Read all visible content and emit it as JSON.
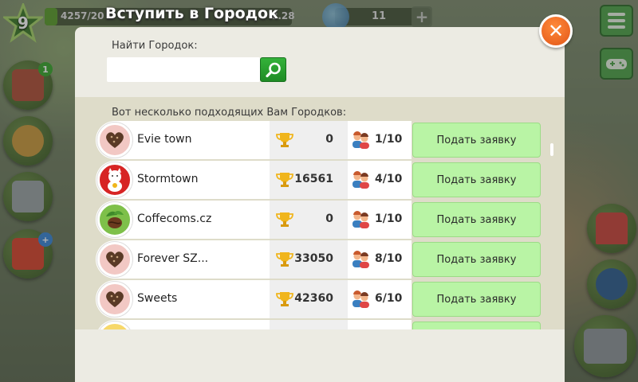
{
  "hud": {
    "level": "9",
    "xp": "4257/20",
    "money": "8.28",
    "gems": "11",
    "plus": "+",
    "side_badge_1": "1",
    "side_badge_2": "+"
  },
  "dialog": {
    "title": "Вступить в Городок",
    "close": "✕",
    "search_label": "Найти Городок:",
    "search_value": "",
    "list_caption": "Вот несколько подходящих Вам Городков:"
  },
  "towns": [
    {
      "name": "Evie town",
      "trophies": "0",
      "members": "1/10",
      "apply": "Подать заявку",
      "avatar": "heart-beans"
    },
    {
      "name": "Stormtown",
      "trophies": "16561",
      "members": "4/10",
      "apply": "Подать заявку",
      "avatar": "lucky-cat"
    },
    {
      "name": "Coffecoms.cz",
      "trophies": "0",
      "members": "1/10",
      "apply": "Подать заявку",
      "avatar": "coffee-leaf"
    },
    {
      "name": "Forever SZ...",
      "trophies": "33050",
      "members": "8/10",
      "apply": "Подать заявку",
      "avatar": "heart-beans"
    },
    {
      "name": "Sweets",
      "trophies": "42360",
      "members": "6/10",
      "apply": "Подать заявку",
      "avatar": "heart-beans"
    }
  ],
  "colors": {
    "accent_green": "#b9f4a5",
    "close_orange": "#f2702a",
    "panel": "#ecebe3"
  }
}
